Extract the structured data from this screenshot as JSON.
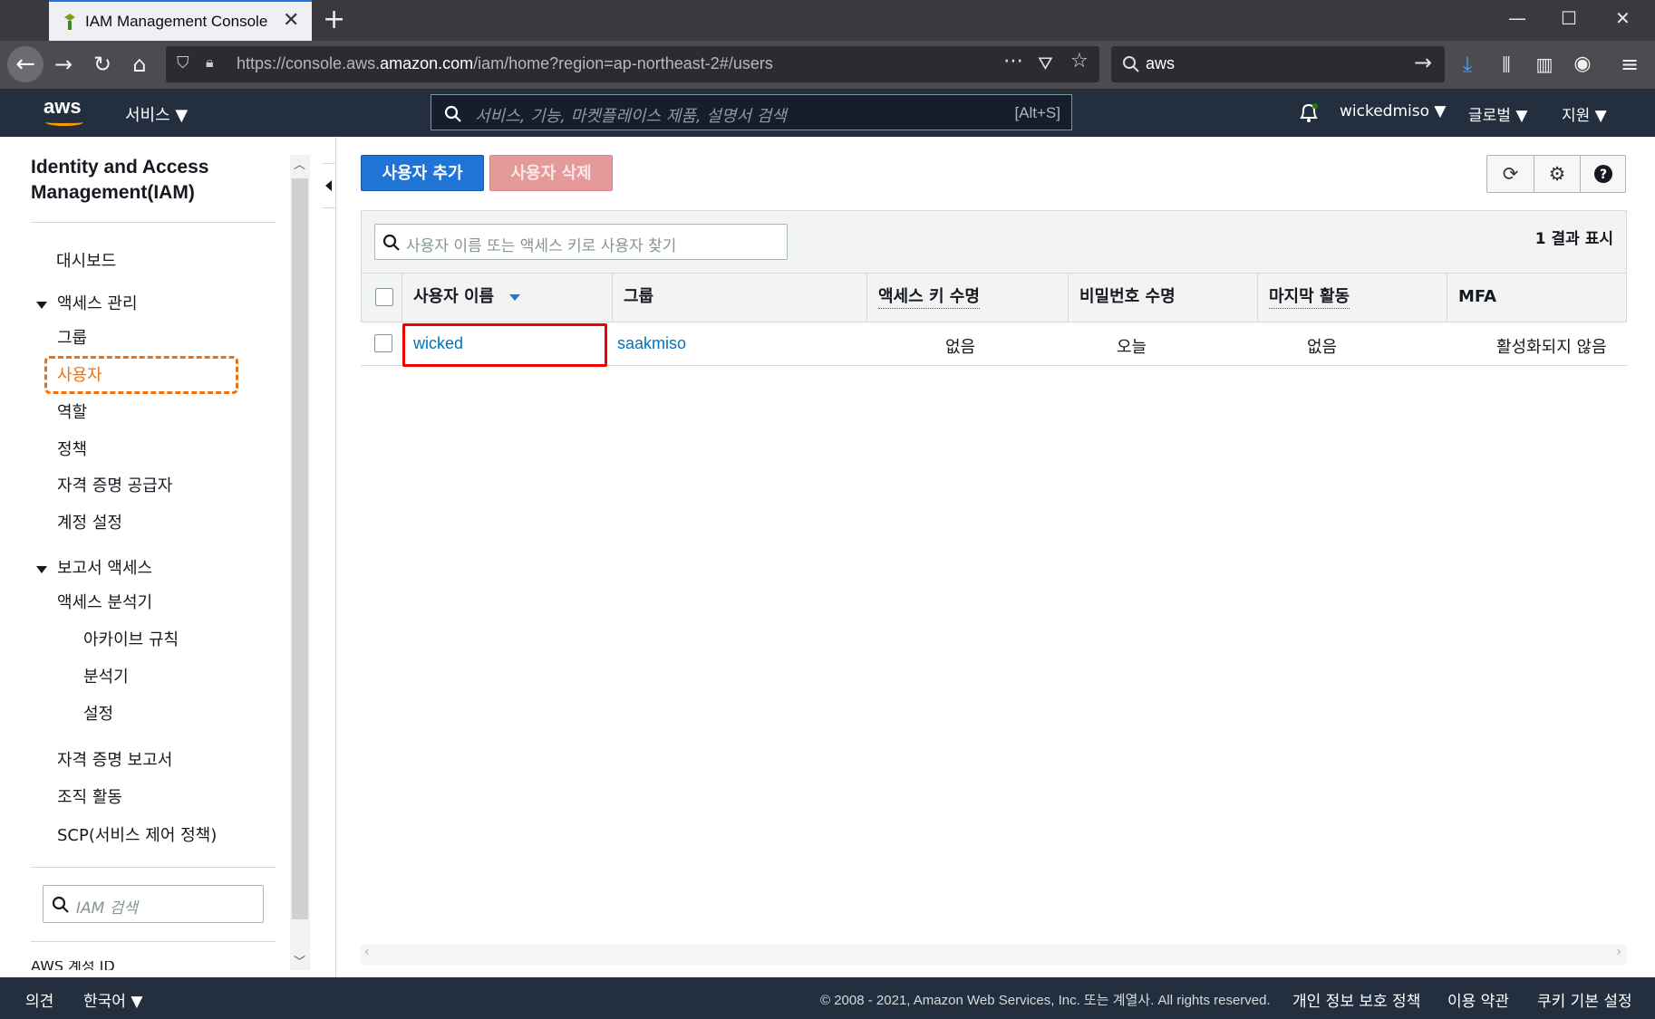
{
  "browser": {
    "tab_title": "IAM Management Console",
    "tab_close": "✕",
    "new_tab": "+",
    "url_prefix": "https://console.aws.",
    "url_domain": "amazon.com",
    "url_path": "/iam/home?region=ap-northeast-2#/users",
    "search_value": "aws"
  },
  "aws_header": {
    "logo": "aws",
    "services_menu": "서비스 ▼",
    "search_placeholder": "서비스, 기능, 마켓플레이스 제품, 설명서 검색",
    "search_shortcut": "[Alt+S]",
    "username": "wickedmiso ▼",
    "region": "글로벌 ▼",
    "support": "지원 ▼"
  },
  "sidebar": {
    "title_line1": "Identity and Access",
    "title_line2": "Management(IAM)",
    "dashboard": "대시보드",
    "access_mgmt": "액세스 관리",
    "groups": "그룹",
    "users": "사용자",
    "roles": "역할",
    "policies": "정책",
    "identity_providers": "자격 증명 공급자",
    "account_settings": "계정 설정",
    "reports_access": "보고서 액세스",
    "access_analyzer": "액세스 분석기",
    "archive_rules": "아카이브 규칙",
    "analyzer": "분석기",
    "settings": "설정",
    "credential_report": "자격 증명 보고서",
    "org_activity": "조직 활동",
    "scp": "SCP(서비스 제어 정책)",
    "search_placeholder": "IAM 검색",
    "cutoff_text": "AWS 계정 ID"
  },
  "main": {
    "add_user": "사용자 추가",
    "delete_user": "사용자 삭제",
    "filter_placeholder": "사용자 이름 또는 액세스 키로 사용자 찾기",
    "result_count": "1 결과 표시",
    "columns": [
      "사용자 이름",
      "그룹",
      "액세스 키 수명",
      "비밀번호 수명",
      "마지막 활동",
      "MFA"
    ],
    "rows": [
      {
        "user": "wicked",
        "group": "saakmiso",
        "access_key_age": "없음",
        "password_age": "오늘",
        "last_activity": "없음",
        "mfa": "활성화되지 않음"
      }
    ]
  },
  "footer": {
    "feedback": "의견",
    "language": "한국어 ▼",
    "copyright": "© 2008 - 2021, Amazon Web Services, Inc. 또는 계열사. All rights reserved.",
    "privacy": "개인 정보 보호 정책",
    "terms": "이용 약관",
    "cookies": "쿠키 기본 설정"
  },
  "colors": {
    "aws_navy": "#232f3e",
    "primary_blue": "#1f74d6",
    "link_blue": "#0073bb",
    "orange_highlight": "#ec7211",
    "red_highlight": "#ee0000"
  }
}
